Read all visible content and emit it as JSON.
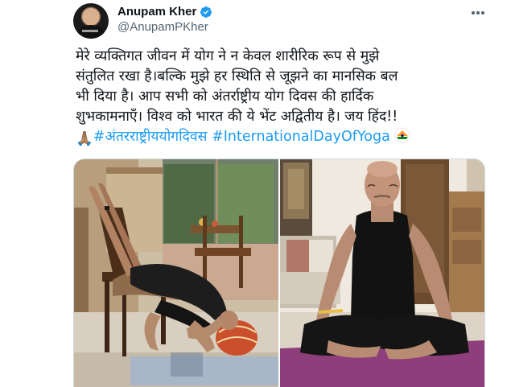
{
  "author": {
    "display_name": "Anupam Kher",
    "handle": "@AnupamPKher",
    "avatar_icon": "avatar-photo",
    "verified_icon": "verified-badge-icon",
    "verified_color": "#1d9bf0"
  },
  "tweet": {
    "text_lines": [
      "मेरे व्यक्तिगत जीवन में योग ने न केवल शारीरिक रूप से मुझे",
      "संतुलित रखा है।बल्कि मुझे हर स्थिति से जूझने का मानसिक बल",
      "भी दिया है। आप सभी को अंतर्राष्ट्रीय योग दिवस की हार्दिक",
      "शुभकामनाएँ। विश्व को भारत की ये भेंट अद्वितीय है। जय हिंद!!"
    ],
    "emoji_folded_hands": "🙏🏽",
    "hashtag_1": "#अंतरराष्ट्रीययोगदिवस",
    "hashtag_2": "#InternationalDayOfYoga",
    "emoji_yoga_icon": "india-yoga-emoji-icon",
    "hashtag_color": "#1d9bf0"
  },
  "media": {
    "photos": [
      {
        "name": "photo-shoulder-stand-pose",
        "scene": "man doing shoulder stand with feet on chair, living room"
      },
      {
        "name": "photo-seated-meditation",
        "scene": "man in black tank top meditating cross-legged on purple mat"
      }
    ]
  },
  "menu": {
    "more_icon": "more-options-icon"
  }
}
